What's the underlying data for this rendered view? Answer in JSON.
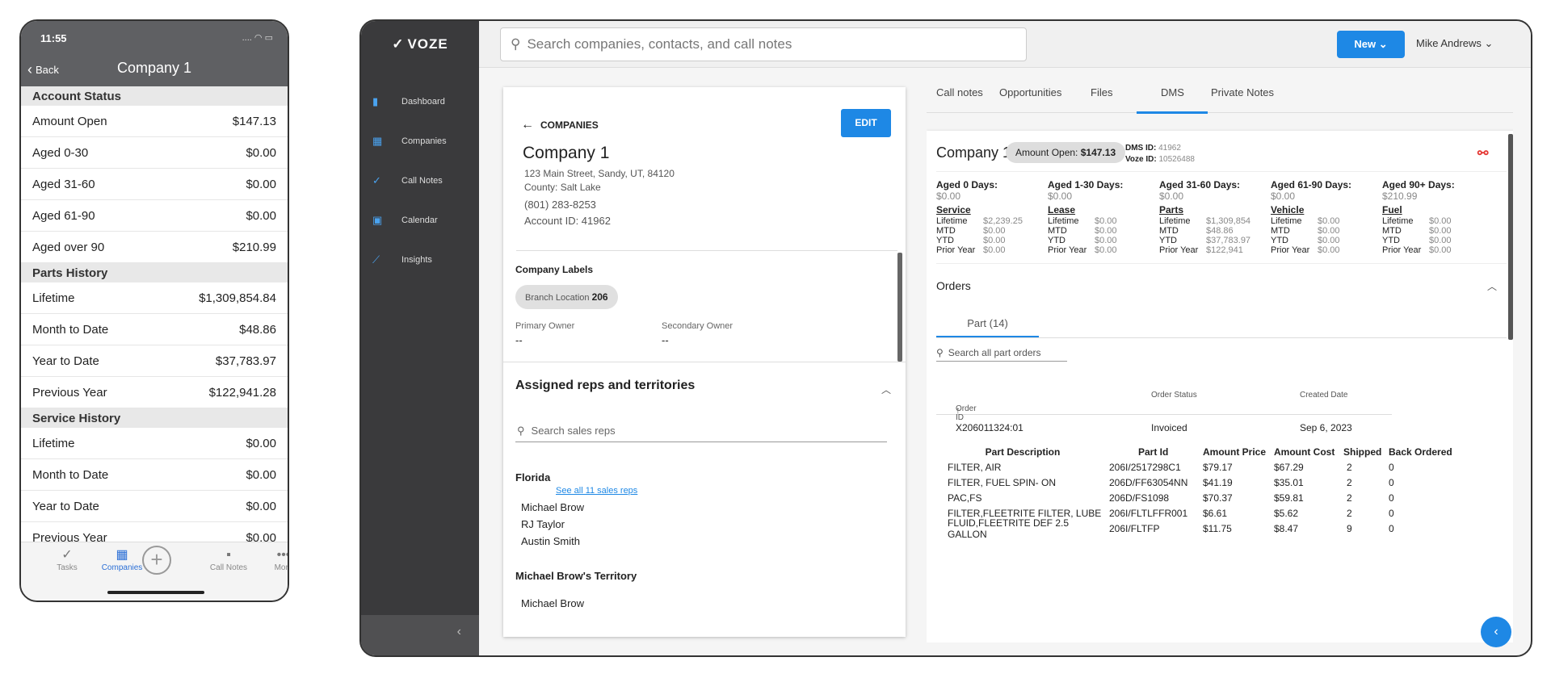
{
  "phone": {
    "time": "11:55",
    "status": "....",
    "back": "Back",
    "title": "Company 1",
    "sections": [
      {
        "header": "Account Status",
        "rows": [
          {
            "label": "Amount Open",
            "value": "$147.13"
          },
          {
            "label": "Aged 0-30",
            "value": "$0.00"
          },
          {
            "label": "Aged 31-60",
            "value": "$0.00"
          },
          {
            "label": "Aged 61-90",
            "value": "$0.00"
          },
          {
            "label": "Aged over 90",
            "value": "$210.99"
          }
        ]
      },
      {
        "header": "Parts History",
        "rows": [
          {
            "label": "Lifetime",
            "value": "$1,309,854.84"
          },
          {
            "label": "Month to Date",
            "value": "$48.86"
          },
          {
            "label": "Year to Date",
            "value": "$37,783.97"
          },
          {
            "label": "Previous Year",
            "value": "$122,941.28"
          }
        ]
      },
      {
        "header": "Service History",
        "rows": [
          {
            "label": "Lifetime",
            "value": "$0.00"
          },
          {
            "label": "Month to Date",
            "value": "$0.00"
          },
          {
            "label": "Year to Date",
            "value": "$0.00"
          },
          {
            "label": "Previous Year",
            "value": "$0.00"
          }
        ]
      }
    ],
    "tabs": {
      "tasks": "Tasks",
      "companies": "Companies",
      "call_notes": "Call Notes",
      "more": "More"
    }
  },
  "tablet": {
    "logo": "VOZE",
    "nav": {
      "dashboard": "Dashboard",
      "companies": "Companies",
      "call_notes": "Call Notes",
      "calendar": "Calendar",
      "insights": "Insights"
    },
    "search_placeholder": "Search companies, contacts, and call notes",
    "new_label": "New",
    "user": "Mike Andrews",
    "company": {
      "back_label": "COMPANIES",
      "edit_label": "EDIT",
      "name": "Company 1",
      "address": "123 Main Street, Sandy, UT, 84120",
      "county": "County: Salt Lake",
      "phone": "(801) 283-8253",
      "account_id": "Account ID: 41962",
      "labels_header": "Company Labels",
      "chip_prefix": "Branch Location",
      "chip_value": "206",
      "primary_owner_label": "Primary Owner",
      "primary_owner_value": "--",
      "secondary_owner_label": "Secondary Owner",
      "secondary_owner_value": "--",
      "assigned_header": "Assigned reps and territories",
      "rep_search_placeholder": "Search sales reps",
      "florida": "Florida",
      "see_all": "See all 11 sales reps",
      "reps": [
        "Michael Brow",
        "RJ Taylor",
        "Austin Smith"
      ],
      "territory": "Michael Brow's Territory",
      "territory_rep": "Michael Brow"
    },
    "tabs": [
      "Call notes",
      "Opportunities",
      "Files",
      "DMS",
      "Private Notes"
    ],
    "dms": {
      "company": "Company 1",
      "amount_open_label": "Amount Open:",
      "amount_open_value": "$147.13",
      "dms_id_label": "DMS ID:",
      "dms_id": "41962",
      "voze_id_label": "Voze ID:",
      "voze_id": "10526488",
      "aged": [
        {
          "label": "Aged 0 Days:",
          "value": "$0.00"
        },
        {
          "label": "Aged 1-30 Days:",
          "value": "$0.00"
        },
        {
          "label": "Aged 31-60 Days:",
          "value": "$0.00"
        },
        {
          "label": "Aged 61-90 Days:",
          "value": "$0.00"
        },
        {
          "label": "Aged 90+ Days:",
          "value": "$210.99"
        }
      ],
      "categories": [
        {
          "name": "Service",
          "lifetime": "$2,239.25",
          "mtd": "$0.00",
          "ytd": "$0.00",
          "prior": "$0.00"
        },
        {
          "name": "Lease",
          "lifetime": "$0.00",
          "mtd": "$0.00",
          "ytd": "$0.00",
          "prior": "$0.00"
        },
        {
          "name": "Parts",
          "lifetime": "$1,309,854",
          "mtd": "$48.86",
          "ytd": "$37,783.97",
          "prior": "$122,941"
        },
        {
          "name": "Vehicle",
          "lifetime": "$0.00",
          "mtd": "$0.00",
          "ytd": "$0.00",
          "prior": "$0.00"
        },
        {
          "name": "Fuel",
          "lifetime": "$0.00",
          "mtd": "$0.00",
          "ytd": "$0.00",
          "prior": "$0.00"
        }
      ],
      "row_labels": {
        "lifetime": "Lifetime",
        "mtd": "MTD",
        "ytd": "YTD",
        "prior": "Prior Year"
      },
      "orders_header": "Orders",
      "part_tab": "Part (14)",
      "part_search_placeholder": "Search all part orders",
      "col_order_id": "Order ID",
      "col_order_status": "Order Status",
      "col_created": "Created Date",
      "order": {
        "id": "X206011324:01",
        "status": "Invoiced",
        "date": "Sep 6, 2023"
      },
      "parts_headers": [
        "Part Description",
        "Part Id",
        "Amount Price",
        "Amount Cost",
        "Shipped",
        "Back Ordered"
      ],
      "parts": [
        [
          "FILTER, AIR",
          "206I/2517298C1",
          "$79.17",
          "$67.29",
          "2",
          "0"
        ],
        [
          "FILTER, FUEL SPIN- ON",
          "206D/FF63054NN",
          "$41.19",
          "$35.01",
          "2",
          "0"
        ],
        [
          "PAC,FS",
          "206D/FS1098",
          "$70.37",
          "$59.81",
          "2",
          "0"
        ],
        [
          "FILTER,FLEETRITE FILTER, LUBE",
          "206I/FLTLFFR001",
          "$6.61",
          "$5.62",
          "2",
          "0"
        ],
        [
          "FLUID,FLEETRITE DEF 2.5 GALLON",
          "206I/FLTFP",
          "$11.75",
          "$8.47",
          "9",
          "0"
        ]
      ]
    }
  }
}
